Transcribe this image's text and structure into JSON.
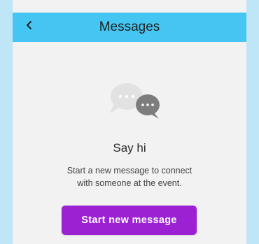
{
  "header": {
    "title": "Messages",
    "back_icon": "chevron-left-icon",
    "background_color": "#45c6f2"
  },
  "empty_state": {
    "illustration_icon": "chat-bubbles-icon",
    "title": "Say hi",
    "description": "Start a new message to connect\nwith someone at the event.",
    "button_label": "Start new message",
    "button_color": "#9c21d3"
  }
}
